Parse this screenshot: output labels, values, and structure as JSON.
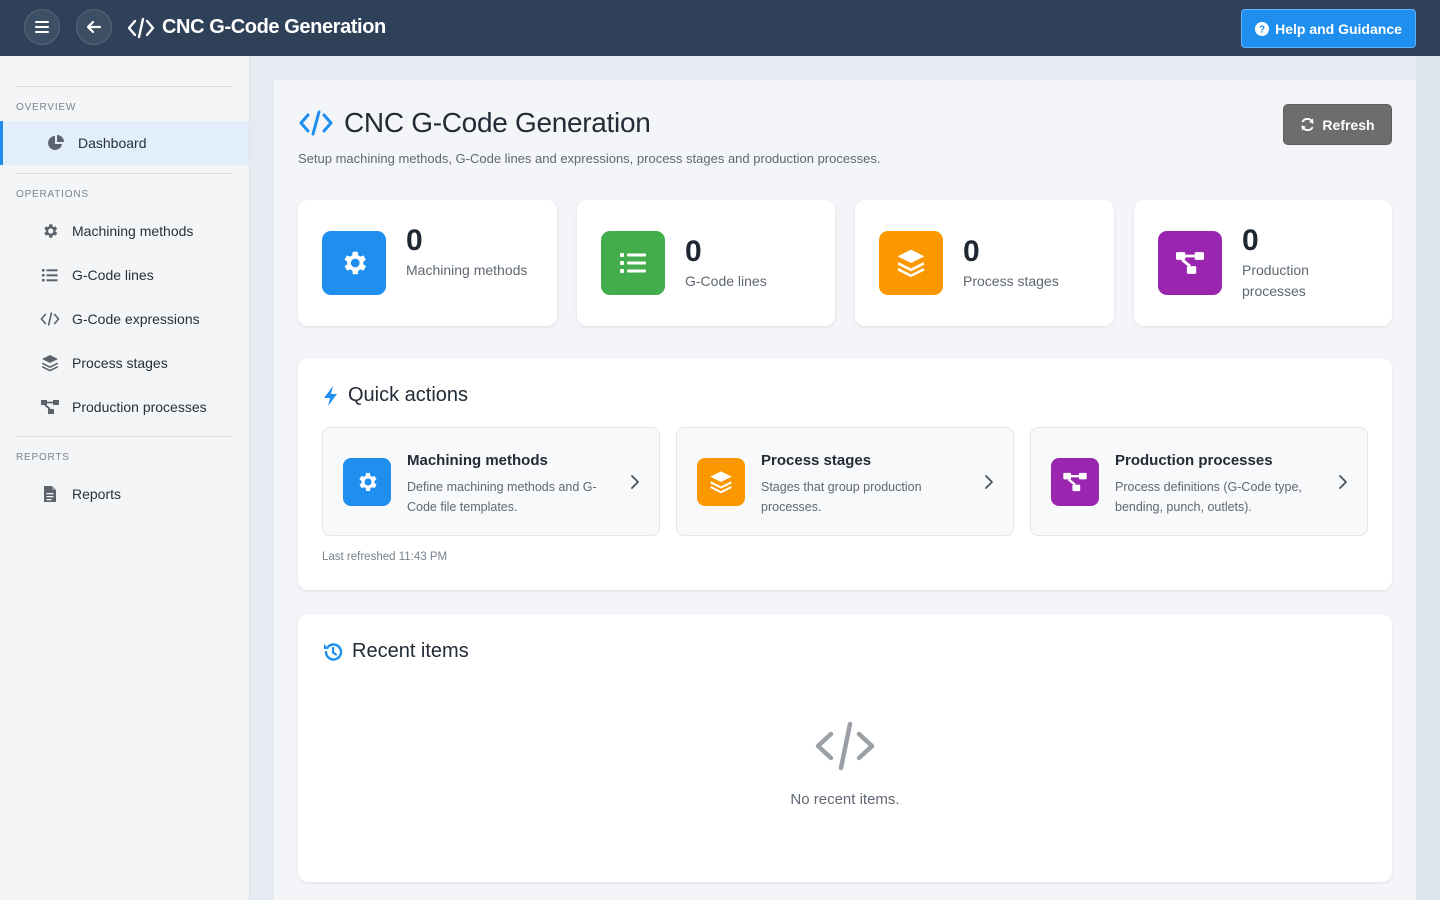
{
  "topbar": {
    "title": "CNC G-Code Generation",
    "help_label": "Help and Guidance"
  },
  "sidebar": {
    "sections": {
      "overview": "OVERVIEW",
      "operations": "OPERATIONS",
      "reports": "REPORTS"
    },
    "items": [
      {
        "label": "Dashboard",
        "icon": "pie-chart-icon",
        "active": true
      },
      {
        "label": "Machining methods",
        "icon": "gear-icon"
      },
      {
        "label": "G-Code lines",
        "icon": "list-icon"
      },
      {
        "label": "G-Code expressions",
        "icon": "code-icon"
      },
      {
        "label": "Process stages",
        "icon": "layers-icon"
      },
      {
        "label": "Production processes",
        "icon": "flow-icon"
      },
      {
        "label": "Reports",
        "icon": "document-icon"
      }
    ]
  },
  "page": {
    "title": "CNC G-Code Generation",
    "subtitle": "Setup machining methods, G-Code lines and expressions, process stages and production processes.",
    "refresh_label": "Refresh"
  },
  "stats": [
    {
      "value": "0",
      "label": "Machining methods",
      "color": "#1e8fef",
      "icon": "gear-icon"
    },
    {
      "value": "0",
      "label": "G-Code lines",
      "color": "#43ad4c",
      "icon": "list-icon"
    },
    {
      "value": "0",
      "label": "Process stages",
      "color": "#fb9800",
      "icon": "layers-icon"
    },
    {
      "value": "0",
      "label": "Production processes",
      "color": "#9a26b0",
      "icon": "flow-icon"
    }
  ],
  "quick_actions": {
    "title": "Quick actions",
    "items": [
      {
        "title": "Machining methods",
        "desc": "Define machining methods and G-Code file templates.",
        "color": "#1e8fef",
        "icon": "gear-icon"
      },
      {
        "title": "Process stages",
        "desc": "Stages that group production processes.",
        "color": "#fb9800",
        "icon": "layers-icon"
      },
      {
        "title": "Production processes",
        "desc": "Process definitions (G-Code type, bending, punch, outlets).",
        "color": "#9a26b0",
        "icon": "flow-icon"
      }
    ],
    "last_refreshed": "Last refreshed 11:43 PM"
  },
  "recent": {
    "title": "Recent items",
    "empty_text": "No recent items."
  },
  "colors": {
    "topbar": "#2f4158",
    "accent": "#1e8fef",
    "refresh": "#6d6d6d"
  }
}
